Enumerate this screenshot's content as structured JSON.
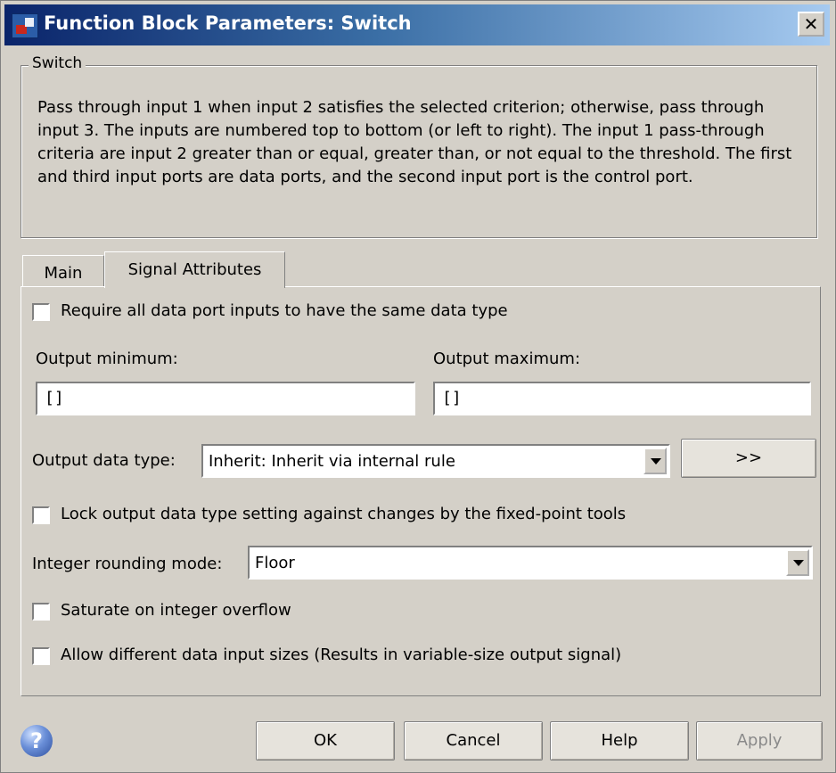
{
  "window": {
    "title": "Function Block Parameters: Switch",
    "close_glyph": "✕"
  },
  "groupbox": {
    "legend": "Switch",
    "description": "Pass through input 1 when input 2 satisfies the selected criterion; otherwise, pass through input 3.  The inputs are numbered top to bottom (or left to right). The input 1 pass-through criteria are input 2 greater than or equal, greater than, or not equal to the threshold.  The first and third input ports are data ports, and the second input port is the control port."
  },
  "tabs": [
    {
      "label": "Main",
      "active": false
    },
    {
      "label": "Signal Attributes",
      "active": true
    }
  ],
  "signal_attributes": {
    "require_same_type": {
      "label": "Require all data port inputs to have the same data type",
      "checked": false
    },
    "output_minimum": {
      "label": "Output minimum:",
      "value": "[]"
    },
    "output_maximum": {
      "label": "Output maximum:",
      "value": "[]"
    },
    "output_data_type": {
      "label": "Output data type:",
      "value": "Inherit: Inherit via internal rule",
      "assistant_label": ">>"
    },
    "lock_output": {
      "label": "Lock output data type setting against changes by the fixed-point tools",
      "checked": false
    },
    "integer_rounding": {
      "label": "Integer rounding mode:",
      "value": "Floor"
    },
    "saturate": {
      "label": "Saturate on integer overflow",
      "checked": false
    },
    "allow_different_sizes": {
      "label": "Allow different data input sizes (Results in variable-size output signal)",
      "checked": false
    }
  },
  "footer": {
    "help_icon_glyph": "?",
    "ok_label": "OK",
    "cancel_label": "Cancel",
    "help_label": "Help",
    "apply_label": "Apply",
    "apply_enabled": false
  }
}
